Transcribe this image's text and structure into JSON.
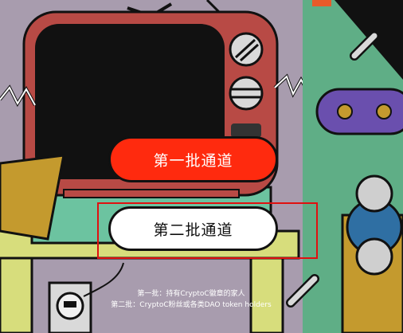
{
  "buttons": {
    "first_channel": "第一批通道",
    "second_channel": "第二批通道"
  },
  "notes": {
    "line1": "第一批：持有CryptoC徽章的家人",
    "line2": "第二批：CryptoC粉丝或各类DAO token holders"
  },
  "colors": {
    "background": "#a89cae",
    "primary_button": "#ff2a0e",
    "secondary_button": "#ffffff",
    "highlight_frame": "#e01010",
    "tv_body": "#b84a45",
    "table": "#d7dd7c",
    "right_panel": "#5fae86"
  },
  "icons": [
    "tv-illustration",
    "table-illustration",
    "power-socket-icon",
    "robot-face-illustration"
  ]
}
